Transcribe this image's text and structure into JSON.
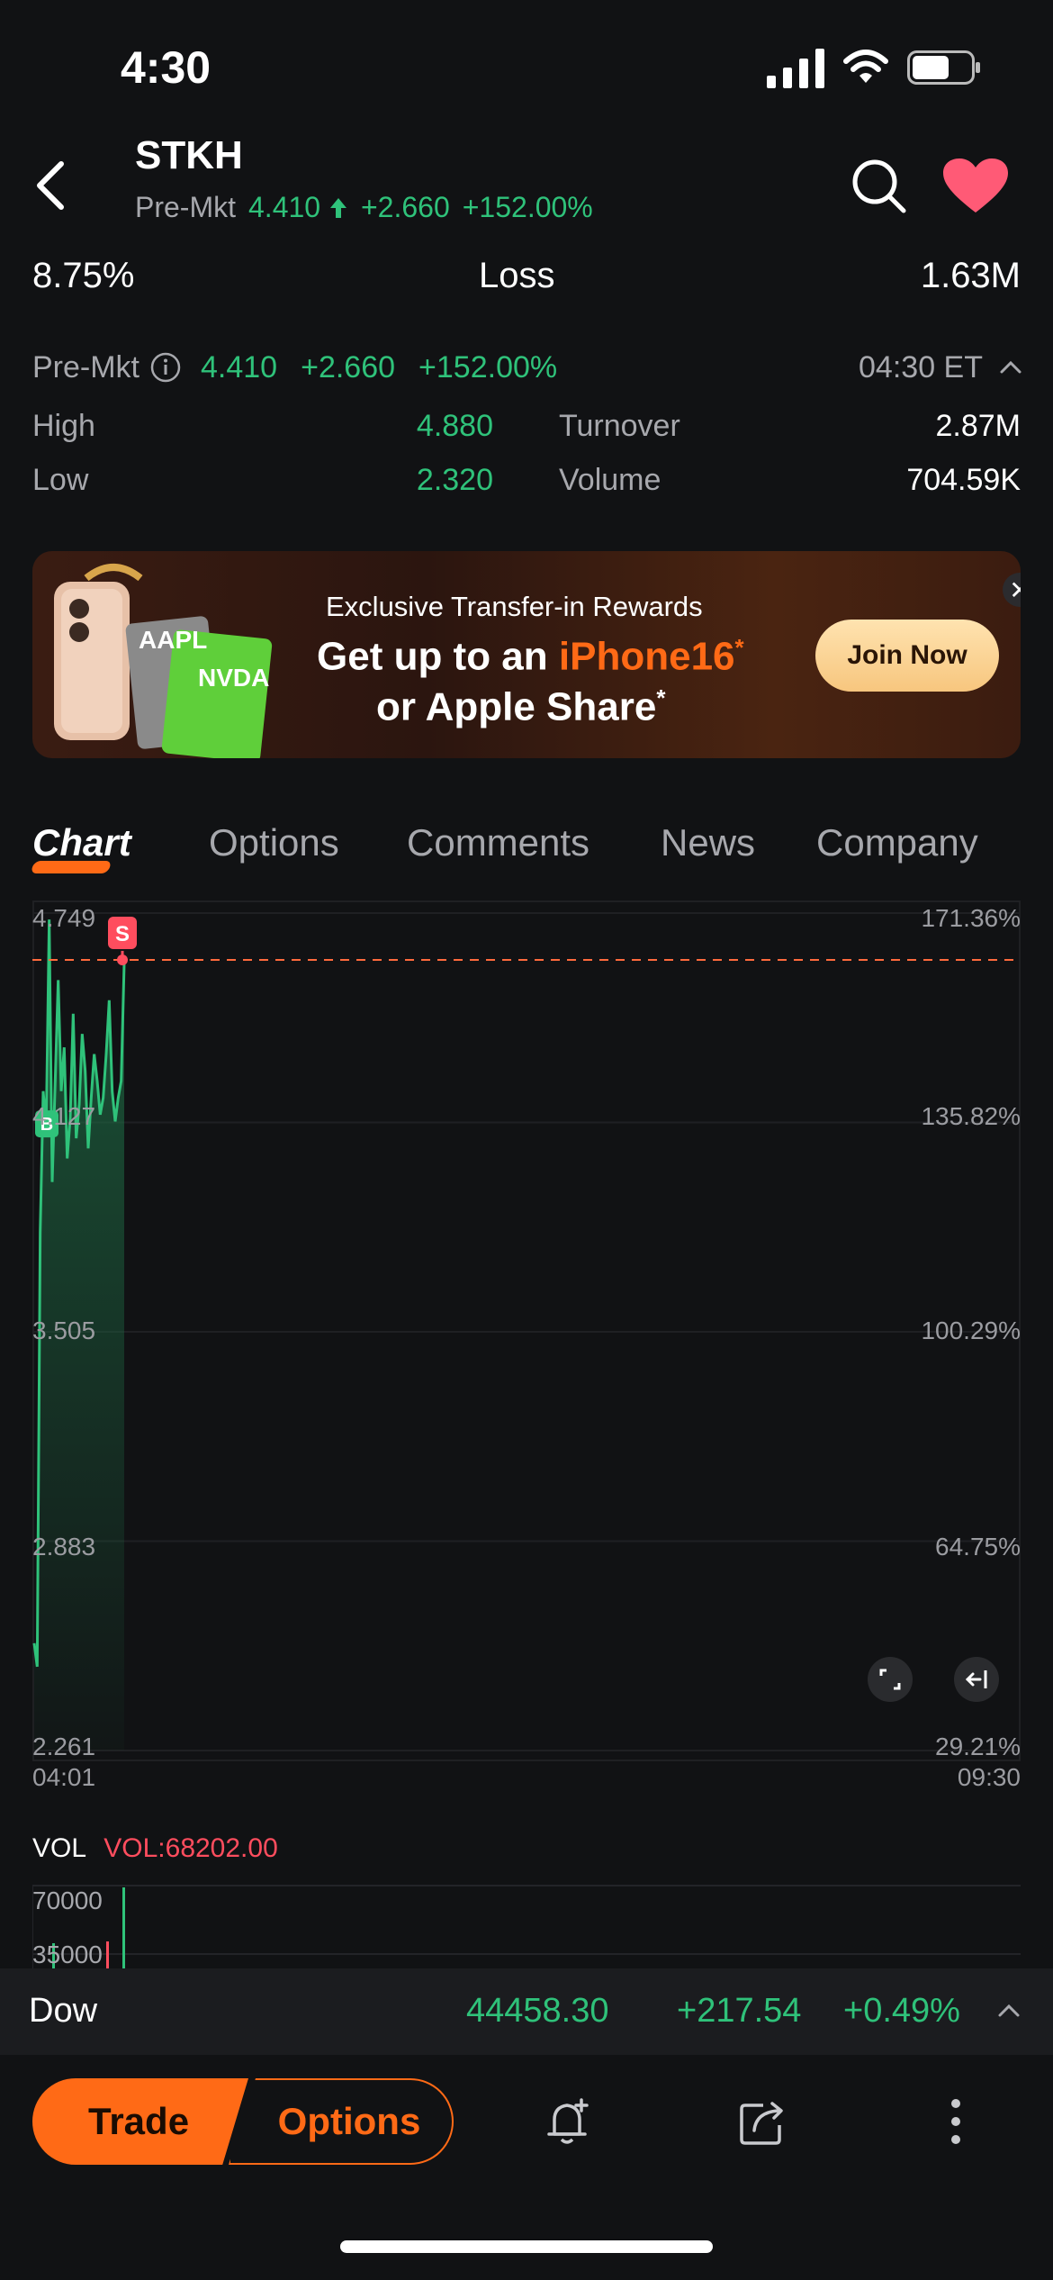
{
  "status": {
    "time": "4:30"
  },
  "header": {
    "ticker": "STKH",
    "pre_label": "Pre-Mkt",
    "price": "4.410",
    "change": "+2.660",
    "pct": "+152.00%"
  },
  "summary_row": {
    "left": "8.75%",
    "center": "Loss",
    "right": "1.63M"
  },
  "premarket": {
    "label": "Pre-Mkt",
    "price": "4.410",
    "change": "+2.660",
    "pct": "+152.00%",
    "time": "04:30 ET",
    "high_label": "High",
    "high": "4.880",
    "low_label": "Low",
    "low": "2.320",
    "turnover_label": "Turnover",
    "turnover": "2.87M",
    "volume_label": "Volume",
    "volume": "704.59K"
  },
  "banner": {
    "line1": "Exclusive Transfer-in Rewards",
    "line2_a": "Get up to an ",
    "line2_b": "iPhone16",
    "line2_star": "*",
    "line3": "or Apple Share",
    "line3_star": "*",
    "card1": "AAPL",
    "card2": "NVDA",
    "join": "Join Now",
    "close": "✕"
  },
  "tabs": [
    "Chart",
    "Options",
    "Comments",
    "News",
    "Company"
  ],
  "chart_data": {
    "type": "area",
    "x_start_label": "04:01",
    "x_end_label": "09:30",
    "y_left_ticks": [
      "4.749",
      "4.127",
      "3.505",
      "2.883",
      "2.261"
    ],
    "y_right_ticks": [
      "171.36%",
      "135.82%",
      "100.29%",
      "64.75%",
      "29.21%"
    ],
    "ylim": [
      2.261,
      4.749
    ],
    "reference_line": 4.61,
    "marker_buy": "B",
    "marker_sell": "S",
    "series": [
      {
        "values": [
          2.58,
          2.51,
          3.8,
          4.22,
          4.11,
          4.73,
          3.95,
          4.25,
          4.55,
          4.22,
          4.35,
          4.02,
          4.14,
          4.45,
          4.08,
          4.18,
          4.39,
          4.28,
          4.05,
          4.2,
          4.33,
          4.25,
          4.15,
          4.2,
          4.33,
          4.49,
          4.22,
          4.13,
          4.2,
          4.25,
          4.6
        ]
      }
    ],
    "colors": {
      "line": "#2fc27a",
      "reference": "#ff6a3d"
    }
  },
  "volume": {
    "label": "VOL",
    "value_label": "VOL:68202.00",
    "ticks": [
      "70000",
      "35000"
    ]
  },
  "index_bar": {
    "name": "Dow",
    "value": "44458.30",
    "change": "+217.54",
    "pct": "+0.49%"
  },
  "bottom": {
    "trade": "Trade",
    "options": "Options"
  }
}
